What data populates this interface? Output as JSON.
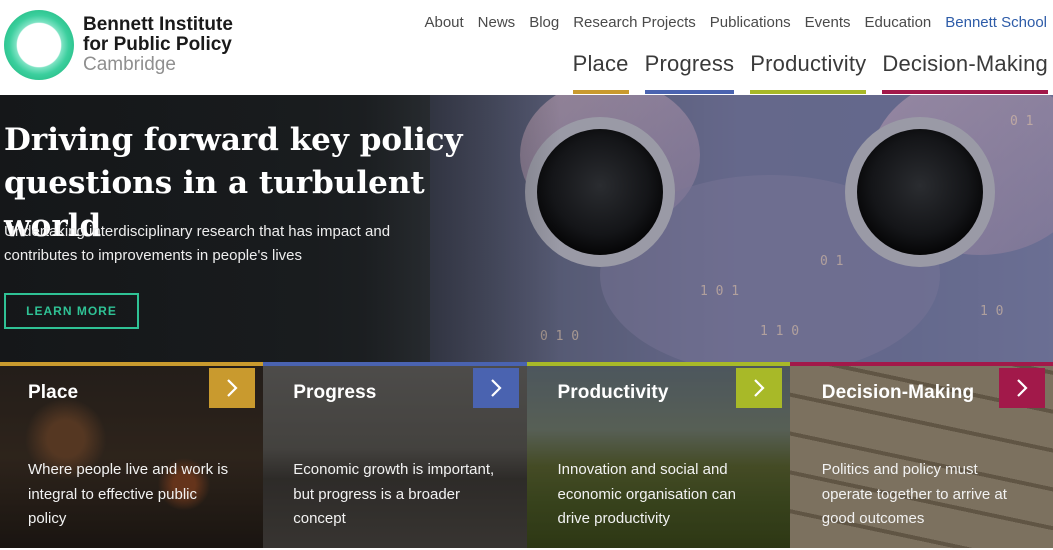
{
  "logo": {
    "line1": "Bennett Institute",
    "line2": "for Public Policy",
    "line3": "Cambridge"
  },
  "topnav": [
    {
      "label": "About"
    },
    {
      "label": "News"
    },
    {
      "label": "Blog"
    },
    {
      "label": "Research Projects"
    },
    {
      "label": "Publications"
    },
    {
      "label": "Events"
    },
    {
      "label": "Education"
    },
    {
      "label": "Bennett School"
    }
  ],
  "mainnav": [
    {
      "label": "Place",
      "color": "#c99a2e"
    },
    {
      "label": "Progress",
      "color": "#4a63b0"
    },
    {
      "label": "Productivity",
      "color": "#a8b928"
    },
    {
      "label": "Decision-Making",
      "color": "#a2194a"
    }
  ],
  "hero": {
    "title": "Driving forward key policy questions in a turbulent world",
    "subtitle": "Undertaking interdisciplinary research that has impact and contributes to improvements in people's lives",
    "button_label": "LEARN MORE",
    "accent": "#2fc295"
  },
  "cards": [
    {
      "title": "Place",
      "desc": "Where people live and work is integral to effective public policy",
      "color": "#c99a2e",
      "arrow_icon": "chevron-right-icon"
    },
    {
      "title": "Progress",
      "desc": "Economic growth is important, but progress is a broader concept",
      "color": "#4a63b0",
      "arrow_icon": "chevron-right-icon"
    },
    {
      "title": "Productivity",
      "desc": "Innovation and social and economic organisation can drive productivity",
      "color": "#a8b928",
      "arrow_icon": "chevron-right-icon"
    },
    {
      "title": "Decision-Making",
      "desc": "Politics and policy must operate together to arrive at good outcomes",
      "color": "#a2194a",
      "arrow_icon": "chevron-right-icon"
    }
  ]
}
